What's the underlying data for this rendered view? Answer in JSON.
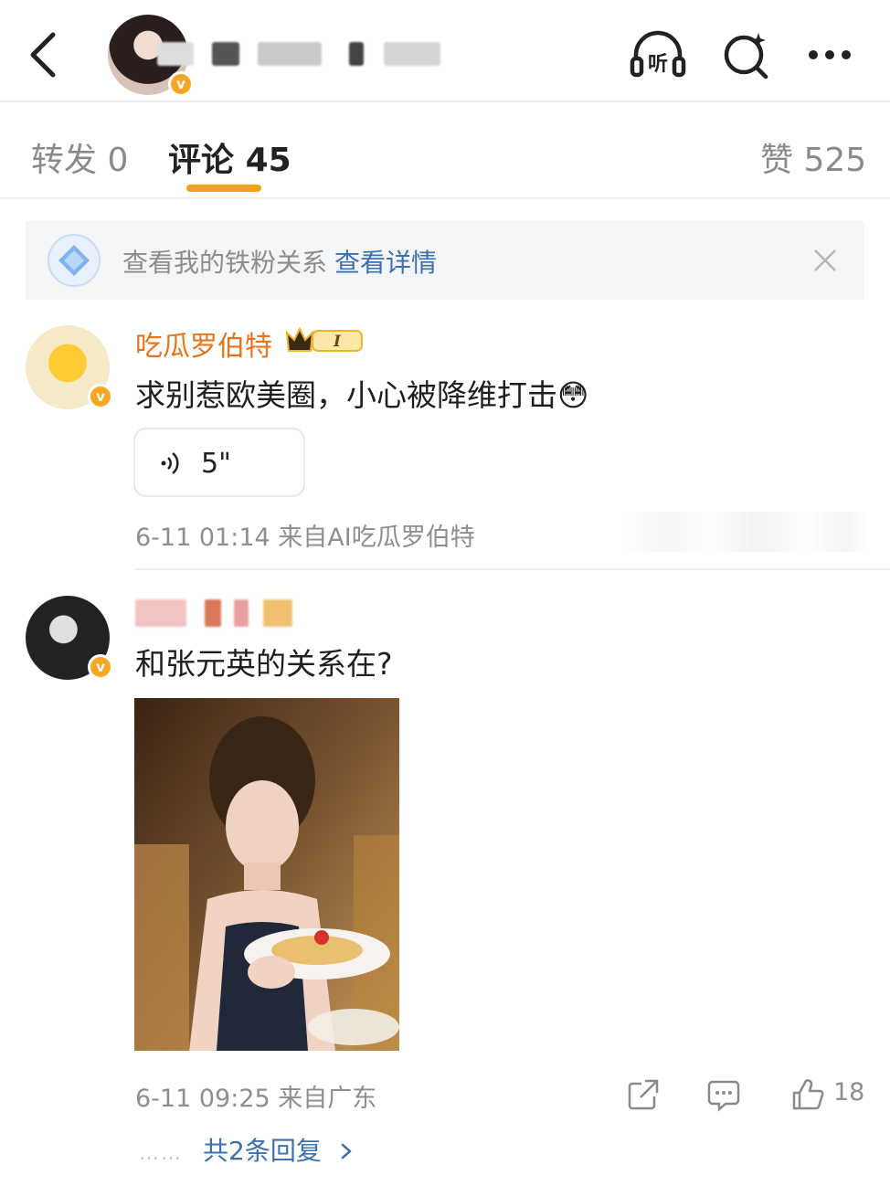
{
  "tabs": {
    "repost_label": "转发",
    "repost_count": "0",
    "comment_label": "评论",
    "comment_count": "45",
    "like_label": "赞",
    "like_count": "525"
  },
  "icons": {
    "listen": "listen-icon",
    "search": "search-icon",
    "more": "more-icon"
  },
  "listen_label": "听",
  "fan_banner": {
    "text": "查看我的铁粉关系",
    "link": "查看详情"
  },
  "comments": [
    {
      "name": "吃瓜罗伯特",
      "level": "I",
      "text": "求别惹欧美圈，小心被降维打击",
      "emoji": "😳",
      "voice_duration": "5\"",
      "time": "6-11 01:14",
      "source": "来自AI吃瓜罗伯特"
    },
    {
      "text": "和张元英的关系在?",
      "time": "6-11 09:25",
      "source": "来自广东",
      "likes": "18",
      "replies": "共2条回复",
      "replies_dots": "……"
    }
  ],
  "colors": {
    "accent": "#f2a21d",
    "name": "#e8731a",
    "link": "#3c6fb0",
    "verified": "#f6a623"
  }
}
